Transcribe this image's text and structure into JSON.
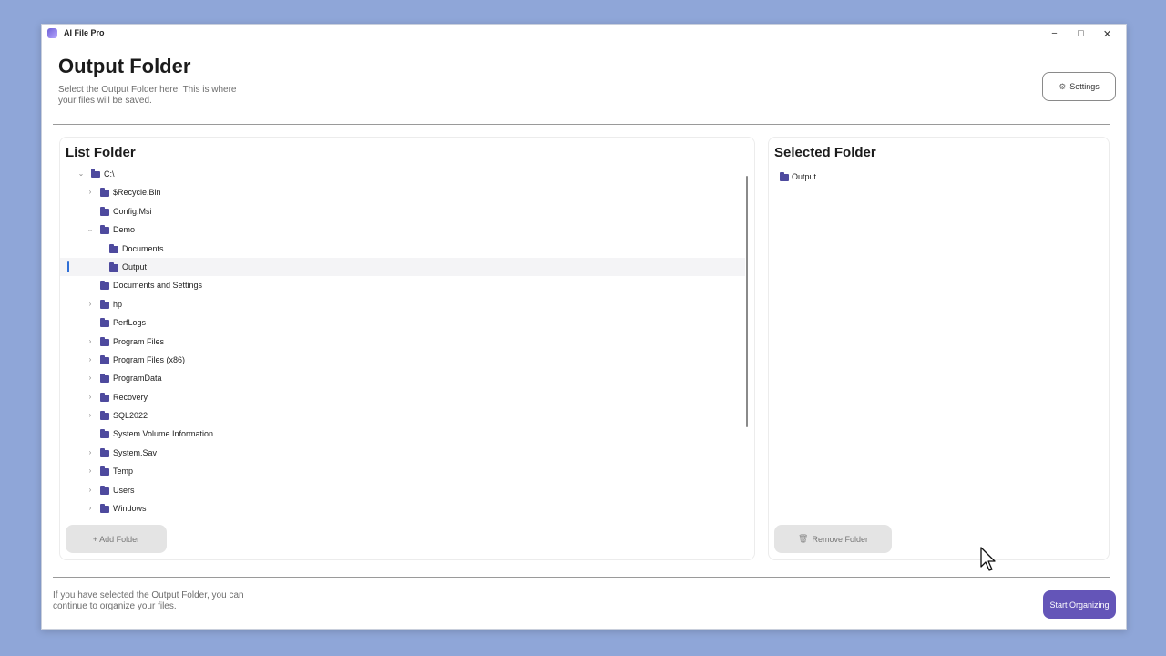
{
  "window": {
    "title": "AI File Pro",
    "controls": {
      "minimize": "−",
      "maximize": "□",
      "close": "✕"
    }
  },
  "header": {
    "title": "Output Folder",
    "subtitle": "Select the Output Folder here. This is where your files will be saved.",
    "settings_label": "Settings",
    "settings_icon": "gear-icon"
  },
  "list_panel": {
    "title": "List Folder",
    "add_button": "+ Add Folder",
    "tree": [
      {
        "label": "C:\\",
        "level": 0,
        "expand": "open",
        "icon": "drive-icon"
      },
      {
        "label": "$Recycle.Bin",
        "level": 1,
        "expand": "closed",
        "icon": "folder-icon"
      },
      {
        "label": "Config.Msi",
        "level": 1,
        "expand": "none",
        "icon": "folder-icon"
      },
      {
        "label": "Demo",
        "level": 1,
        "expand": "open",
        "icon": "folder-icon"
      },
      {
        "label": "Documents",
        "level": 2,
        "expand": "none",
        "icon": "folder-icon"
      },
      {
        "label": "Output",
        "level": 2,
        "expand": "none",
        "icon": "folder-icon",
        "selected": true
      },
      {
        "label": "Documents and Settings",
        "level": 1,
        "expand": "none",
        "icon": "folder-icon"
      },
      {
        "label": "hp",
        "level": 1,
        "expand": "closed",
        "icon": "folder-icon"
      },
      {
        "label": "PerfLogs",
        "level": 1,
        "expand": "none",
        "icon": "folder-icon"
      },
      {
        "label": "Program Files",
        "level": 1,
        "expand": "closed",
        "icon": "folder-icon"
      },
      {
        "label": "Program Files (x86)",
        "level": 1,
        "expand": "closed",
        "icon": "folder-icon"
      },
      {
        "label": "ProgramData",
        "level": 1,
        "expand": "closed",
        "icon": "folder-icon"
      },
      {
        "label": "Recovery",
        "level": 1,
        "expand": "closed",
        "icon": "folder-icon"
      },
      {
        "label": "SQL2022",
        "level": 1,
        "expand": "closed",
        "icon": "folder-icon"
      },
      {
        "label": "System Volume Information",
        "level": 1,
        "expand": "none",
        "icon": "folder-icon"
      },
      {
        "label": "System.Sav",
        "level": 1,
        "expand": "closed",
        "icon": "folder-icon"
      },
      {
        "label": "Temp",
        "level": 1,
        "expand": "closed",
        "icon": "folder-icon"
      },
      {
        "label": "Users",
        "level": 1,
        "expand": "closed",
        "icon": "folder-icon"
      },
      {
        "label": "Windows",
        "level": 1,
        "expand": "closed",
        "icon": "folder-icon"
      }
    ]
  },
  "selected_panel": {
    "title": "Selected Folder",
    "items": [
      "Output"
    ],
    "remove_button": "Remove Folder",
    "remove_icon": "trash-icon"
  },
  "footer": {
    "text": "If you have selected the Output Folder, you can continue to organize your files.",
    "start_button": "Start Organizing"
  },
  "colors": {
    "desktop": "#8fa6d8",
    "accent": "#6455b8",
    "folder": "#4e4a9e",
    "selection_marker": "#2f6fd6"
  }
}
